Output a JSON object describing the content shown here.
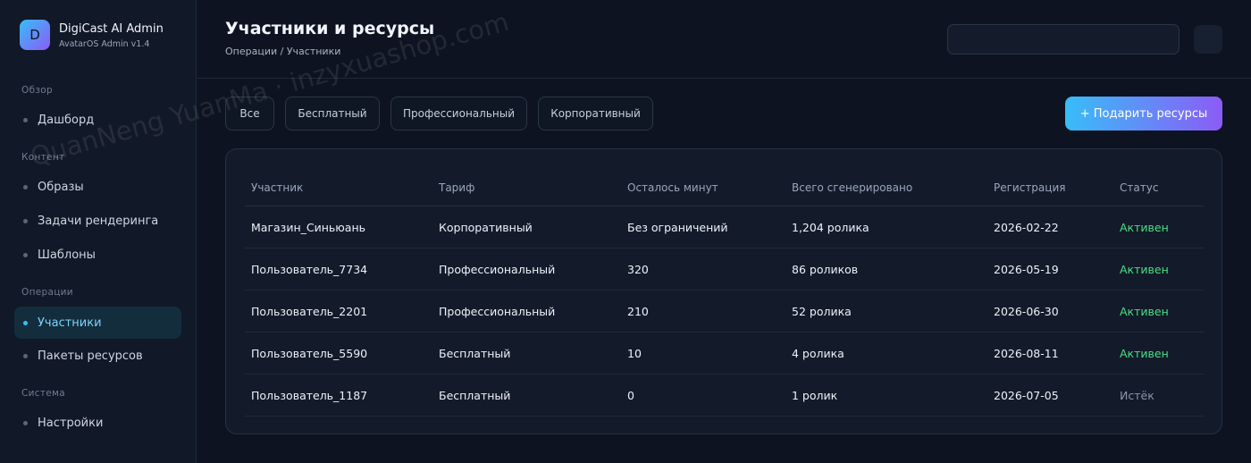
{
  "brand": {
    "logo_letter": "D",
    "title": "DigiCast AI Admin",
    "subtitle": "AvatarOS Admin v1.4"
  },
  "sidebar": {
    "sections": [
      {
        "label": "Обзор",
        "items": [
          {
            "label": "Дашборд",
            "active": false
          }
        ]
      },
      {
        "label": "Контент",
        "items": [
          {
            "label": "Образы",
            "active": false
          },
          {
            "label": "Задачи рендеринга",
            "active": false
          },
          {
            "label": "Шаблоны",
            "active": false
          }
        ]
      },
      {
        "label": "Операции",
        "items": [
          {
            "label": "Участники",
            "active": true
          },
          {
            "label": "Пакеты ресурсов",
            "active": false
          }
        ]
      },
      {
        "label": "Система",
        "items": [
          {
            "label": "Настройки",
            "active": false
          }
        ]
      }
    ]
  },
  "header": {
    "title": "Участники и ресурсы",
    "breadcrumb": "Операции / Участники",
    "search": {
      "value": "",
      "placeholder": ""
    }
  },
  "filters": [
    "Все",
    "Бесплатный",
    "Профессиональный",
    "Корпоративный"
  ],
  "gift_button": "+ Подарить ресурсы",
  "table": {
    "columns": [
      "Участник",
      "Тариф",
      "Осталось минут",
      "Всего сгенерировано",
      "Регистрация",
      "Статус"
    ],
    "rows": [
      [
        "Магазин_Синьюань",
        "Корпоративный",
        "Без ограничений",
        "1,204 ролика",
        "2026-02-22",
        "Активен"
      ],
      [
        "Пользователь_7734",
        "Профессиональный",
        "320",
        "86 роликов",
        "2026-05-19",
        "Активен"
      ],
      [
        "Пользователь_2201",
        "Профессиональный",
        "210",
        "52 ролика",
        "2026-06-30",
        "Активен"
      ],
      [
        "Пользователь_5590",
        "Бесплатный",
        "10",
        "4 ролика",
        "2026-08-11",
        "Активен"
      ],
      [
        "Пользователь_1187",
        "Бесплатный",
        "0",
        "1 ролик",
        "2026-07-05",
        "Истёк"
      ]
    ]
  },
  "watermark": "QuanNeng YuanMa · inzyxuashop.com",
  "colors": {
    "accent": "#38bdf8",
    "accent2": "#8b5cf6",
    "active_status": "#4ade80",
    "expired_status": "#8b95a5",
    "background": "#0d1320"
  }
}
